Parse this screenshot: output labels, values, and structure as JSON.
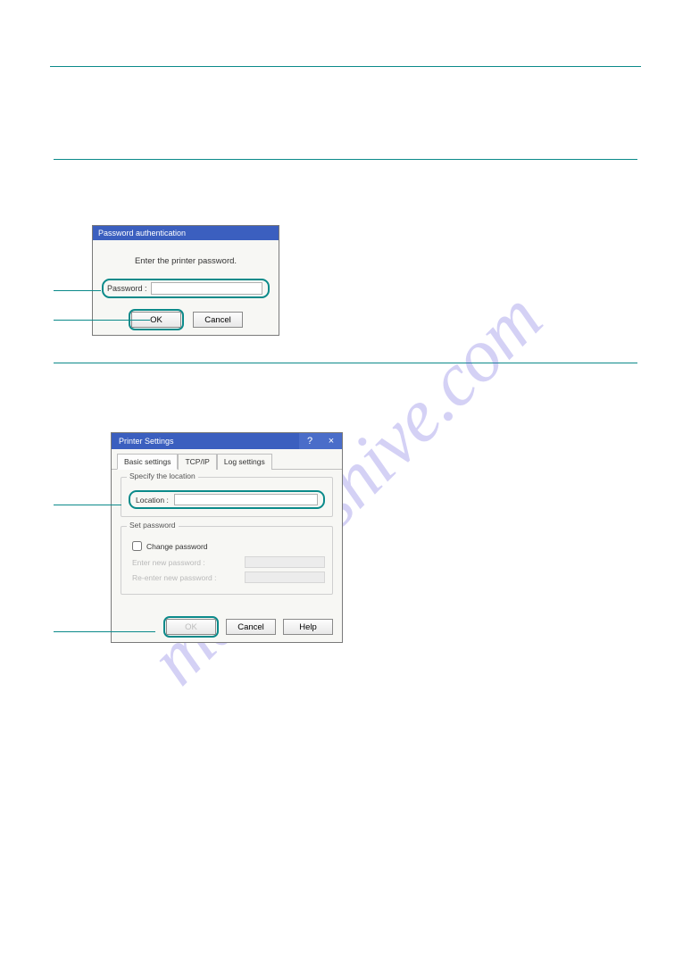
{
  "watermark_text": "manualshive.com",
  "dialog1": {
    "title": "Password authentication",
    "prompt": "Enter the printer password.",
    "password_label": "Password :",
    "password_value": "",
    "ok_label": "OK",
    "cancel_label": "Cancel"
  },
  "dialog2": {
    "title": "Printer Settings",
    "help_glyph": "?",
    "close_glyph": "×",
    "tabs": {
      "basic": "Basic settings",
      "tcpip": "TCP/IP",
      "log": "Log settings"
    },
    "group_location": {
      "title": "Specify the location",
      "label": "Location :",
      "value": ""
    },
    "group_password": {
      "title": "Set password",
      "change_label": "Change password",
      "change_checked": false,
      "enter_label": "Enter new password :",
      "reenter_label": "Re-enter new password :"
    },
    "ok_label": "OK",
    "cancel_label": "Cancel",
    "help_label": "Help"
  }
}
